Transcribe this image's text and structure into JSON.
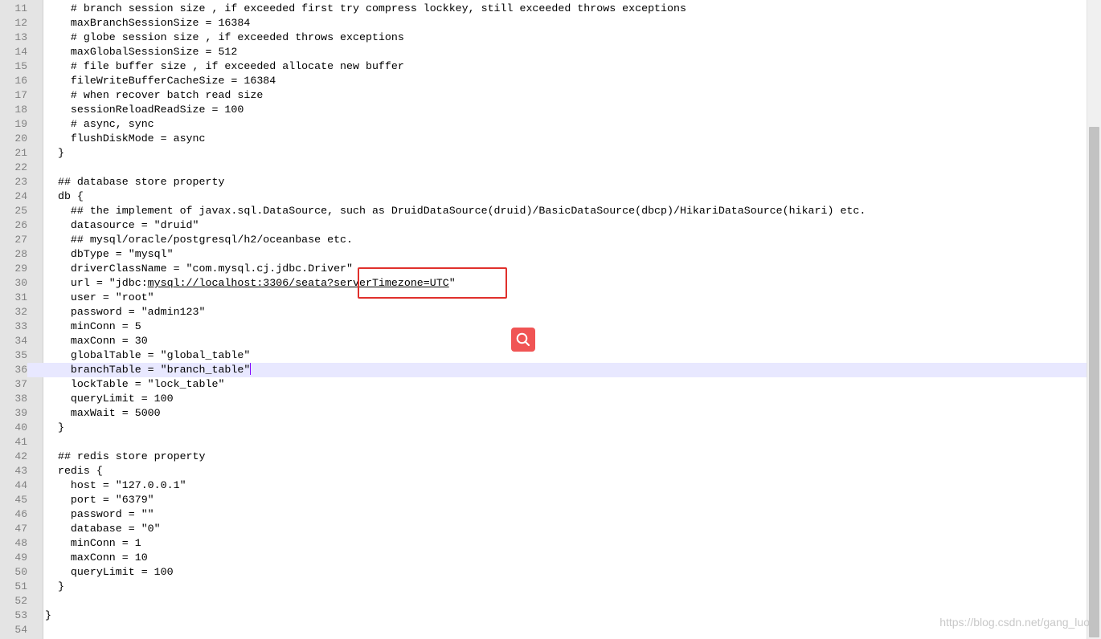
{
  "editor": {
    "current_line": 36,
    "caret_after_text": "    branchTable = \"branch_table\"",
    "lines": [
      {
        "n": "11",
        "text": "    # branch session size , if exceeded first try compress lockkey, still exceeded throws exceptions"
      },
      {
        "n": "12",
        "text": "    maxBranchSessionSize = 16384"
      },
      {
        "n": "13",
        "text": "    # globe session size , if exceeded throws exceptions"
      },
      {
        "n": "14",
        "text": "    maxGlobalSessionSize = 512"
      },
      {
        "n": "15",
        "text": "    # file buffer size , if exceeded allocate new buffer"
      },
      {
        "n": "16",
        "text": "    fileWriteBufferCacheSize = 16384"
      },
      {
        "n": "17",
        "text": "    # when recover batch read size"
      },
      {
        "n": "18",
        "text": "    sessionReloadReadSize = 100"
      },
      {
        "n": "19",
        "text": "    # async, sync"
      },
      {
        "n": "20",
        "text": "    flushDiskMode = async"
      },
      {
        "n": "21",
        "text": "  }"
      },
      {
        "n": "22",
        "text": ""
      },
      {
        "n": "23",
        "text": "  ## database store property"
      },
      {
        "n": "24",
        "text": "  db {"
      },
      {
        "n": "25",
        "text": "    ## the implement of javax.sql.DataSource, such as DruidDataSource(druid)/BasicDataSource(dbcp)/HikariDataSource(hikari) etc."
      },
      {
        "n": "26",
        "text": "    datasource = \"druid\""
      },
      {
        "n": "27",
        "text": "    ## mysql/oracle/postgresql/h2/oceanbase etc."
      },
      {
        "n": "28",
        "text": "    dbType = \"mysql\""
      },
      {
        "n": "29",
        "text": "    driverClassName = \"com.mysql.cj.jdbc.Driver\""
      },
      {
        "n": "30",
        "text": "    url = \"jdbc:mysql://localhost:3306/seata?serverTimezone=UTC\""
      },
      {
        "n": "31",
        "text": "    user = \"root\""
      },
      {
        "n": "32",
        "text": "    password = \"admin123\""
      },
      {
        "n": "33",
        "text": "    minConn = 5"
      },
      {
        "n": "34",
        "text": "    maxConn = 30"
      },
      {
        "n": "35",
        "text": "    globalTable = \"global_table\""
      },
      {
        "n": "36",
        "text": "    branchTable = \"branch_table\""
      },
      {
        "n": "37",
        "text": "    lockTable = \"lock_table\""
      },
      {
        "n": "38",
        "text": "    queryLimit = 100"
      },
      {
        "n": "39",
        "text": "    maxWait = 5000"
      },
      {
        "n": "40",
        "text": "  }"
      },
      {
        "n": "41",
        "text": ""
      },
      {
        "n": "42",
        "text": "  ## redis store property"
      },
      {
        "n": "43",
        "text": "  redis {"
      },
      {
        "n": "44",
        "text": "    host = \"127.0.0.1\""
      },
      {
        "n": "45",
        "text": "    port = \"6379\""
      },
      {
        "n": "46",
        "text": "    password = \"\""
      },
      {
        "n": "47",
        "text": "    database = \"0\""
      },
      {
        "n": "48",
        "text": "    minConn = 1"
      },
      {
        "n": "49",
        "text": "    maxConn = 10"
      },
      {
        "n": "50",
        "text": "    queryLimit = 100"
      },
      {
        "n": "51",
        "text": "  }"
      },
      {
        "n": "52",
        "text": ""
      },
      {
        "n": "53",
        "text": "}"
      },
      {
        "n": "54",
        "text": ""
      }
    ],
    "url_line": {
      "prefix": "    url = \"jdbc:",
      "link": "mysql://localhost:3306/seata?serverTimezone=UTC",
      "suffix": "\""
    }
  },
  "overlay": {
    "search_icon": "magnifier-icon",
    "search_button_color": "#f05454",
    "highlight_color": "#e0302c"
  },
  "watermark": "https://blog.csdn.net/gang_luo"
}
